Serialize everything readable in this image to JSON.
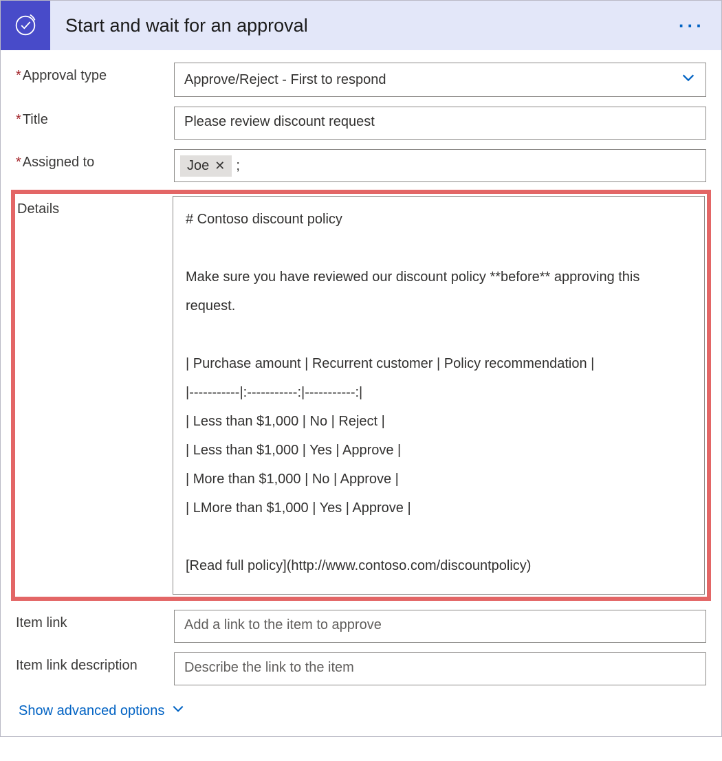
{
  "header": {
    "title": "Start and wait for an approval"
  },
  "fields": {
    "approval_type": {
      "label": "Approval type",
      "required": true,
      "value": "Approve/Reject - First to respond"
    },
    "title": {
      "label": "Title",
      "required": true,
      "value": "Please review discount request"
    },
    "assigned_to": {
      "label": "Assigned to",
      "required": true,
      "tokens": [
        "Joe"
      ],
      "separator": ";"
    },
    "details": {
      "label": "Details",
      "value": "# Contoso discount policy\n\nMake sure you have reviewed our discount policy **before** approving this request.\n\n| Purchase amount | Recurrent customer | Policy recommendation |\n|-----------|:-----------:|-----------:|\n| Less than $1,000 | No | Reject |\n| Less than $1,000 | Yes | Approve |\n| More than $1,000 | No | Approve |\n| LMore than $1,000 | Yes | Approve |\n\n[Read full policy](http://www.contoso.com/discountpolicy)"
    },
    "item_link": {
      "label": "Item link",
      "placeholder": "Add a link to the item to approve"
    },
    "item_link_description": {
      "label": "Item link description",
      "placeholder": "Describe the link to the item"
    }
  },
  "footer": {
    "advanced_label": "Show advanced options"
  }
}
